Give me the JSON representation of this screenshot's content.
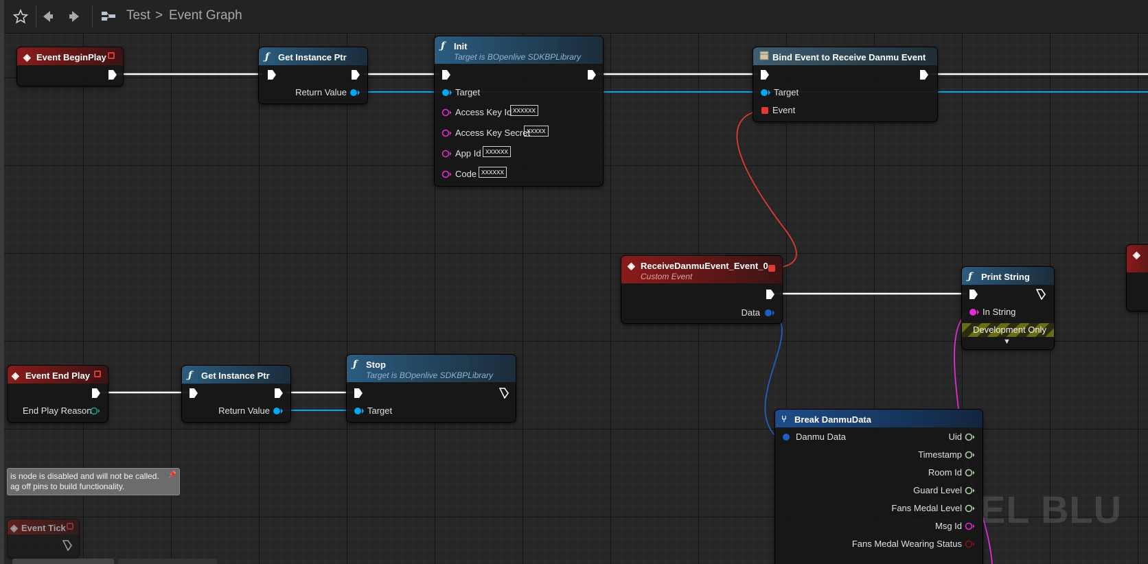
{
  "toolbar": {
    "star_icon": "star-icon",
    "back_icon": "back-arrow-icon",
    "forward_icon": "forward-arrow-icon",
    "graph_icon": "blueprint-graph-icon",
    "crumb_root": "Test",
    "crumb_sep": ">",
    "crumb_current": "Event Graph"
  },
  "nodes": {
    "begin_play": {
      "title": "Event BeginPlay"
    },
    "get_instance_1": {
      "title": "Get Instance Ptr",
      "out_label": "Return Value"
    },
    "init": {
      "title": "Init",
      "subtitle": "Target is BOpenlive SDKBPLibrary",
      "target": "Target",
      "pins": [
        {
          "label": "Access Key Id",
          "value": "xxxxxx"
        },
        {
          "label": "Access Key Secret",
          "value": "xxxxx"
        },
        {
          "label": "App Id",
          "value": "xxxxxx"
        },
        {
          "label": "Code",
          "value": "xxxxxx"
        }
      ]
    },
    "bind_event": {
      "title": "Bind Event to Receive Danmu Event",
      "target": "Target",
      "event": "Event"
    },
    "receive_event": {
      "title": "ReceiveDanmuEvent_Event_0",
      "subtitle": "Custom Event",
      "data": "Data"
    },
    "print_string": {
      "title": "Print String",
      "in_string": "In String",
      "dev_only": "Development Only"
    },
    "end_play": {
      "title": "Event End Play",
      "reason": "End Play Reason"
    },
    "get_instance_2": {
      "title": "Get Instance Ptr",
      "out_label": "Return Value"
    },
    "stop": {
      "title": "Stop",
      "subtitle": "Target is BOpenlive SDKBPLibrary",
      "target": "Target"
    },
    "break_danmu": {
      "title": "Break DanmuData",
      "input": "Danmu Data",
      "outputs": [
        "Uid",
        "Timestamp",
        "Room Id",
        "Guard Level",
        "Fans Medal Level",
        "Msg Id",
        "Fans Medal Wearing Status"
      ]
    },
    "event_tick": {
      "title": "Event Tick"
    }
  },
  "comment": {
    "line1": "is node is disabled and will not be called.",
    "line2": "ag off pins to build functionality."
  },
  "watermark": "LEVEL BLU",
  "colors": {
    "exec_wire": "#ffffff",
    "object_wire": "#00a8f2",
    "struct_wire": "#1f5fc4",
    "delegate_wire": "#e03b30",
    "string_wire": "#e52bd3",
    "event_header": "#8b1a1a",
    "function_header": "#2b5c80",
    "struct_header": "#1e4d8a"
  }
}
